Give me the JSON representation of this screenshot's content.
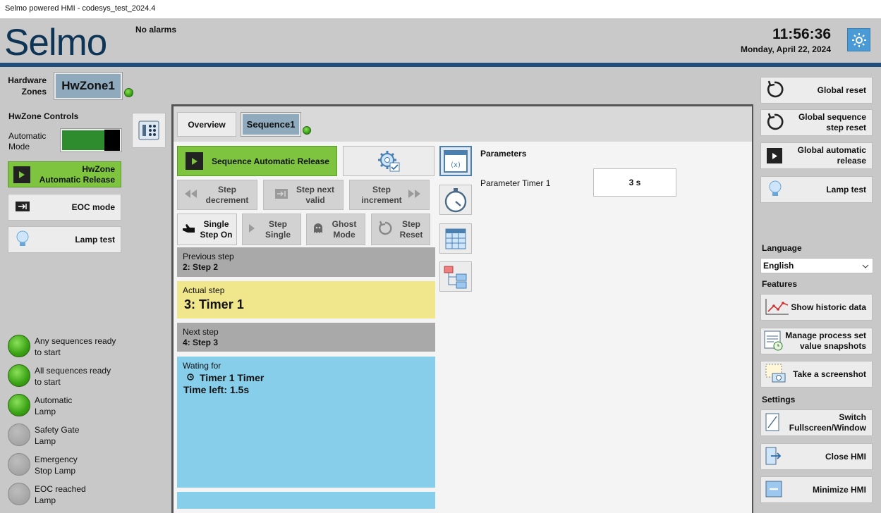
{
  "window": {
    "title": "Selmo powered HMI - codesys_test_2024.4"
  },
  "header": {
    "logo": "Selmo",
    "alarms": "No alarms",
    "time": "11:56:36",
    "date": "Monday, April 22, 2024"
  },
  "left": {
    "hw_zones_label_1": "Hardware",
    "hw_zones_label_2": "Zones",
    "zone_name": "HwZone1",
    "controls_title": "HwZone Controls",
    "auto_mode_1": "Automatic",
    "auto_mode_2": "Mode",
    "release_1": "HwZone",
    "release_2": "Automatic Release",
    "eoc_mode": "EOC mode",
    "lamp_test": "Lamp test",
    "lamps": [
      {
        "l1": "Any sequences ready",
        "l2": "to start",
        "state": "green"
      },
      {
        "l1": "All sequences ready",
        "l2": "to start",
        "state": "green"
      },
      {
        "l1": "Automatic",
        "l2": "Lamp",
        "state": "green"
      },
      {
        "l1": "Safety Gate",
        "l2": "Lamp",
        "state": "gray"
      },
      {
        "l1": "Emergency",
        "l2": "Stop Lamp",
        "state": "gray"
      },
      {
        "l1": "EOC reached",
        "l2": "Lamp",
        "state": "gray"
      }
    ]
  },
  "center": {
    "tab_overview": "Overview",
    "tab_sequence": "Sequence1",
    "seq_auto_release": "Sequence Automatic Release",
    "step_decrement_1": "Step",
    "step_decrement_2": "decrement",
    "step_next_1": "Step next",
    "step_next_2": "valid",
    "step_increment_1": "Step",
    "step_increment_2": "increment",
    "single_step_1": "Single",
    "single_step_2": "Step On",
    "step_single_1": "Step",
    "step_single_2": "Single",
    "ghost_1": "Ghost",
    "ghost_2": "Mode",
    "step_reset_1": "Step",
    "step_reset_2": "Reset",
    "prev_label": "Previous step",
    "prev_value": "2: Step 2",
    "actual_label": "Actual step",
    "actual_value": "3: Timer 1",
    "next_label": "Next step",
    "next_value": "4: Step 3",
    "waiting_label": "Wating for",
    "waiting_item": "Timer 1 Timer",
    "time_left": "Time left: 1.5s",
    "params_title": "Parameters",
    "param_name": "Parameter Timer 1",
    "param_value": "3 s"
  },
  "right": {
    "global_reset": "Global reset",
    "global_seq_reset_1": "Global sequence",
    "global_seq_reset_2": "step reset",
    "global_auto_1": "Global automatic",
    "global_auto_2": "release",
    "lamp_test": "Lamp test",
    "language_title": "Language",
    "language_value": "English",
    "features_title": "Features",
    "historic": "Show historic data",
    "snapshots_1": "Manage process set",
    "snapshots_2": "value snapshots",
    "screenshot": "Take a screenshot",
    "settings_title": "Settings",
    "fullscreen_1": "Switch",
    "fullscreen_2": "Fullscreen/Window",
    "close": "Close HMI",
    "minimize": "Minimize HMI"
  },
  "colors": {
    "brand": "#0f3556",
    "accent_blue": "#1d4e7c",
    "green": "#7ec43e",
    "actual_step": "#f0e68c",
    "waiting": "#87ceeb"
  }
}
